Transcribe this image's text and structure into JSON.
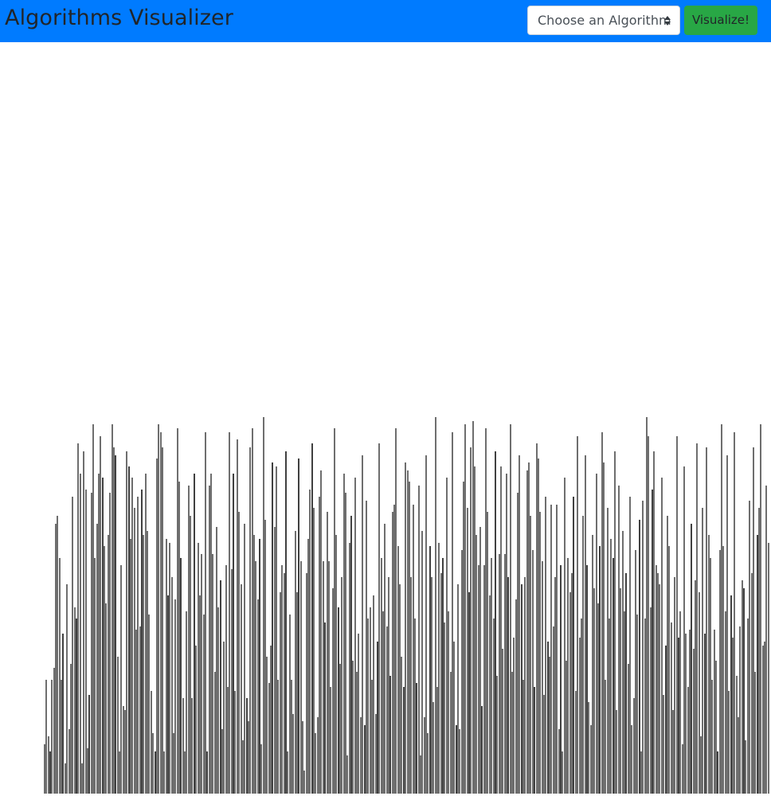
{
  "navbar": {
    "brand": "Algorithms Visualizer",
    "background_color": "#007bff"
  },
  "algorithm_select": {
    "selected_label": "Choose an Algorithm",
    "caret_icon": "sort-caret-icon"
  },
  "visualize_button": {
    "label": "Visualize!",
    "color": "#28a745"
  },
  "array": {
    "bar_color": "#6e6e6e",
    "values": [
      13,
      30,
      15,
      11,
      30,
      33,
      71,
      73,
      62,
      30,
      42,
      8,
      55,
      17,
      34,
      78,
      49,
      46,
      92,
      84,
      8,
      90,
      80,
      12,
      26,
      79,
      97,
      62,
      71,
      84,
      94,
      83,
      65,
      50,
      68,
      79,
      97,
      91,
      89,
      36,
      11,
      60,
      23,
      22,
      90,
      86,
      67,
      83,
      75,
      43,
      78,
      44,
      80,
      68,
      84,
      69,
      47,
      27,
      16,
      11,
      88,
      97,
      95,
      91,
      11,
      67,
      52,
      66,
      57,
      16,
      51,
      96,
      82,
      62,
      25,
      11,
      48,
      81,
      73,
      25,
      84,
      39,
      66,
      52,
      63,
      47,
      95,
      11,
      81,
      84,
      63,
      32,
      70,
      49,
      56,
      17,
      40,
      60,
      28,
      95,
      59,
      84,
      27,
      93,
      74,
      55,
      14,
      71,
      25,
      19,
      91,
      96,
      68,
      61,
      51,
      67,
      13,
      99,
      72,
      36,
      29,
      39,
      87,
      70,
      86,
      30,
      53,
      60,
      58,
      90,
      11,
      47,
      30,
      21,
      69,
      53,
      88,
      61,
      19,
      6,
      58,
      67,
      80,
      92,
      75,
      16,
      20,
      78,
      85,
      61,
      45,
      74,
      61,
      28,
      54,
      96,
      68,
      49,
      34,
      57,
      84,
      79,
      10,
      66,
      73,
      35,
      83,
      32,
      42,
      20,
      89,
      18,
      77,
      46,
      49,
      30,
      52,
      21,
      40,
      92,
      62,
      48,
      71,
      44,
      57,
      31,
      74,
      76,
      96,
      65,
      55,
      36,
      28,
      87,
      85,
      82,
      57,
      76,
      46,
      29,
      81,
      10,
      69,
      20,
      89,
      16,
      65,
      57,
      24,
      99,
      28,
      66,
      58,
      62,
      45,
      83,
      48,
      32,
      95,
      40,
      18,
      55,
      17,
      64,
      82,
      97,
      75,
      53,
      91,
      98,
      86,
      68,
      60,
      70,
      23,
      60,
      96,
      74,
      52,
      62,
      46,
      90,
      31,
      63,
      86,
      38,
      63,
      84,
      57,
      97,
      32,
      41,
      51,
      79,
      89,
      55,
      30,
      57,
      85,
      87,
      73,
      64,
      28,
      92,
      88,
      74,
      61,
      26,
      78,
      40,
      36,
      76,
      44,
      57,
      76,
      17,
      60,
      11,
      83,
      35,
      62,
      53,
      58,
      78,
      27,
      94,
      41,
      46,
      73,
      89,
      60,
      24,
      18,
      68,
      54,
      84,
      50,
      65,
      95,
      87,
      30,
      75,
      46,
      67,
      62,
      90,
      22,
      81,
      54,
      69,
      48,
      58,
      34,
      78,
      18,
      25,
      64,
      47,
      72,
      11,
      77,
      46,
      99,
      94,
      49,
      80,
      90,
      60,
      58,
      55,
      83,
      26,
      39,
      73,
      65,
      45,
      22,
      57,
      94,
      41,
      48,
      13,
      86,
      42,
      28,
      43,
      71,
      38,
      56,
      92,
      53,
      15,
      75,
      42,
      91,
      68,
      62,
      30,
      43,
      35,
      11,
      64,
      97,
      65,
      48,
      89,
      27,
      52,
      41,
      95,
      31,
      20,
      44,
      56,
      54,
      14,
      46,
      77,
      58,
      91,
      32,
      68,
      75,
      97,
      39,
      40,
      81,
      66
    ]
  }
}
